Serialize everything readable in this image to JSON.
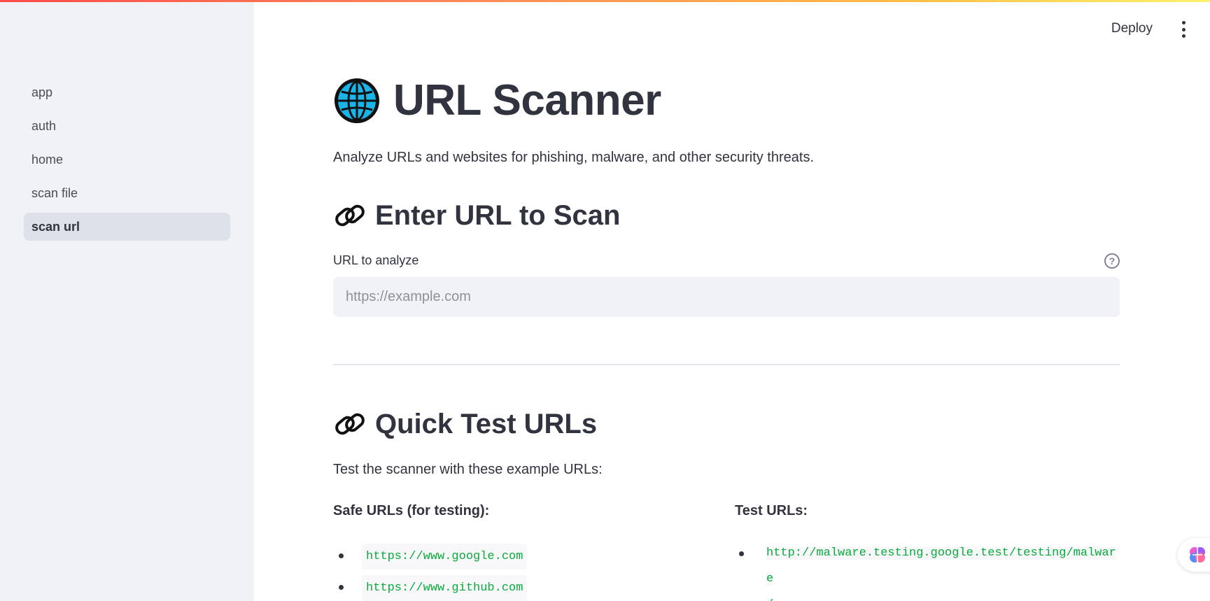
{
  "sidebar": {
    "items": [
      {
        "label": "app"
      },
      {
        "label": "auth"
      },
      {
        "label": "home"
      },
      {
        "label": "scan file"
      },
      {
        "label": "scan url",
        "active": true
      }
    ]
  },
  "header": {
    "deploy_label": "Deploy",
    "menu_icon": "kebab-menu-icon"
  },
  "main": {
    "title": "URL Scanner",
    "title_icon": "globe-icon",
    "subtitle": "Analyze URLs and websites for phishing, malware, and other security threats.",
    "scan_section": {
      "heading": "Enter URL to Scan",
      "icon": "link-icon",
      "field_label": "URL to analyze",
      "placeholder": "https://example.com",
      "value": "",
      "help_icon": "question-circle-icon"
    },
    "quick_section": {
      "heading": "Quick Test URLs",
      "icon": "link-icon",
      "intro": "Test the scanner with these example URLs:",
      "safe_title": "Safe URLs (for testing):",
      "safe_urls": [
        "https://www.google.com",
        "https://www.github.com"
      ],
      "test_title": "Test URLs:",
      "test_urls": [
        "http://malware.testing.google.test/testing/malware/"
      ],
      "test_url_lines": [
        "http://malware.testing.google.test/testing/malware",
        "/"
      ]
    }
  },
  "colors": {
    "accent_gradient": [
      "#ff4b4b",
      "#ffbd45",
      "#fff36b"
    ],
    "sidebar_bg": "#f0f2f6",
    "code_green": "#09ab3b",
    "text": "#31333f"
  }
}
